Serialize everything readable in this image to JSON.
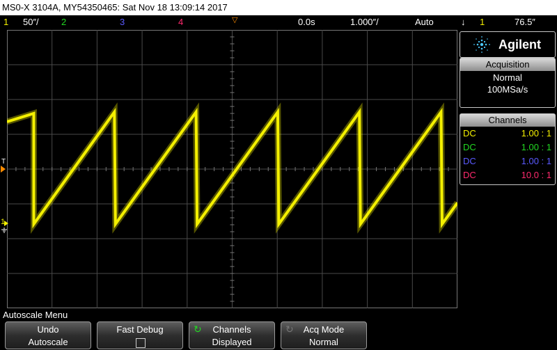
{
  "title_bar": {
    "text": "MS0-X 3104A, MY54350465: Sat Nov 18 13:09:14 2017"
  },
  "status": {
    "ch1_number": "1",
    "ch1_scale": "50″/",
    "ch2_number": "2",
    "ch3_number": "3",
    "ch4_number": "4",
    "trigger_pos_marker": "▽",
    "time_delay": "0.0s",
    "time_scale": "1.000″/",
    "trigger_mode": "Auto",
    "trigger_slope_icon": "↓",
    "trigger_channel": "1",
    "trigger_level": "76.5″"
  },
  "colors": {
    "ch1": "#f4f000",
    "ch2": "#22d822",
    "ch3": "#5a5aff",
    "ch4": "#ff2a6e",
    "grid": "#4a4a4a",
    "trigger_marker": "#ff8c00"
  },
  "markers": {
    "trigger_level_label": "T",
    "ch1_ground_label": "1"
  },
  "brand": {
    "name": "Agilent"
  },
  "acquisition": {
    "header": "Acquisition",
    "mode": "Normal",
    "rate": "100MSa/s"
  },
  "channels_panel": {
    "header": "Channels",
    "rows": [
      {
        "coupling": "DC",
        "ratio": "1.00 : 1"
      },
      {
        "coupling": "DC",
        "ratio": "1.00 : 1"
      },
      {
        "coupling": "DC",
        "ratio": "1.00 : 1"
      },
      {
        "coupling": "DC",
        "ratio": "10.0 : 1"
      }
    ]
  },
  "menu": {
    "title": "Autoscale Menu"
  },
  "softkeys": [
    {
      "line1": "Undo",
      "line2": "Autoscale"
    },
    {
      "line1": "Fast Debug",
      "line2": ""
    },
    {
      "line1": "Channels",
      "line2": "Displayed"
    },
    {
      "line1": "Acq Mode",
      "line2": "Normal"
    }
  ],
  "waveform": {
    "type": "sawtooth",
    "channel": "1",
    "periods_visible": 5.5
  }
}
